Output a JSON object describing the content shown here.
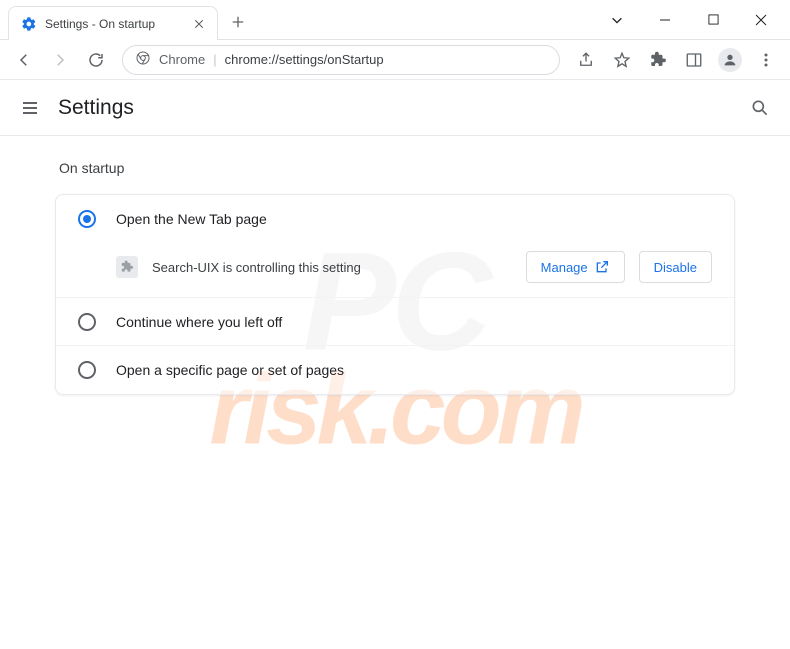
{
  "tab": {
    "title": "Settings - On startup"
  },
  "omnibox": {
    "site_label": "Chrome",
    "url_path": "chrome://settings/onStartup"
  },
  "settings": {
    "title": "Settings",
    "section_label": "On startup",
    "options": {
      "new_tab": "Open the New Tab page",
      "continue": "Continue where you left off",
      "specific": "Open a specific page or set of pages"
    },
    "controlled_by": {
      "message": "Search-UIX is controlling this setting",
      "manage_label": "Manage",
      "disable_label": "Disable"
    }
  },
  "watermark": {
    "line1": "PC",
    "line2": "risk.com"
  }
}
